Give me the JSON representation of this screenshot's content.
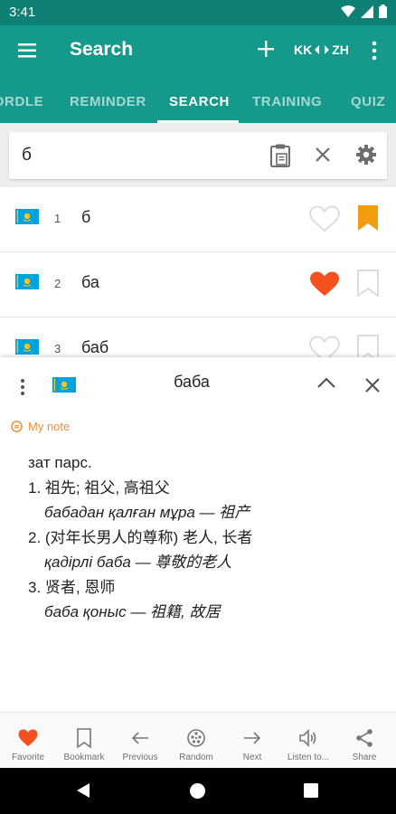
{
  "status_bar": {
    "time": "3:41"
  },
  "app_bar": {
    "title": "Search",
    "lang_from": "KK",
    "lang_to": "ZH"
  },
  "tabs": [
    {
      "label": "WORDLE",
      "active": false
    },
    {
      "label": "REMINDER",
      "active": false
    },
    {
      "label": "SEARCH",
      "active": true
    },
    {
      "label": "TRAINING",
      "active": false
    },
    {
      "label": "QUIZ",
      "active": false
    }
  ],
  "search": {
    "query": "б"
  },
  "results": [
    {
      "num": "1",
      "word": "б",
      "favorite": false,
      "bookmarked": true
    },
    {
      "num": "2",
      "word": "ба",
      "favorite": true,
      "bookmarked": false
    },
    {
      "num": "3",
      "word": "баб",
      "favorite": false,
      "bookmarked": false
    }
  ],
  "detail": {
    "word": "баба",
    "note_label": "My note",
    "lines": [
      {
        "text": "зат парс.",
        "type": "pos"
      },
      {
        "text": "1. 祖先; 祖父, 高祖父",
        "type": "sense"
      },
      {
        "text": "бабадан қалған мұра — 祖产",
        "type": "example"
      },
      {
        "text": "2. (对年长男人的尊称) 老人, 长者",
        "type": "sense"
      },
      {
        "text": "қадірлі баба — 尊敬的老人",
        "type": "example"
      },
      {
        "text": "3. 贤者, 恩师",
        "type": "sense"
      },
      {
        "text": "баба қоныс — 祖籍, 故居",
        "type": "example"
      }
    ]
  },
  "bottom_nav": [
    {
      "label": "Favorite",
      "icon": "heart-icon"
    },
    {
      "label": "Bookmark",
      "icon": "bookmark-icon"
    },
    {
      "label": "Previous",
      "icon": "arrow-left-icon"
    },
    {
      "label": "Random",
      "icon": "dice-icon"
    },
    {
      "label": "Next",
      "icon": "arrow-right-icon"
    },
    {
      "label": "Listen to...",
      "icon": "speaker-icon"
    },
    {
      "label": "Share",
      "icon": "share-icon"
    }
  ],
  "colors": {
    "primary": "#14998a",
    "primary_dark": "#0e8074",
    "favorite": "#f4511e",
    "bookmark": "#f39c12",
    "note": "#e8923a",
    "flag": "#00a3dd",
    "flag_sun": "#fec50c"
  }
}
